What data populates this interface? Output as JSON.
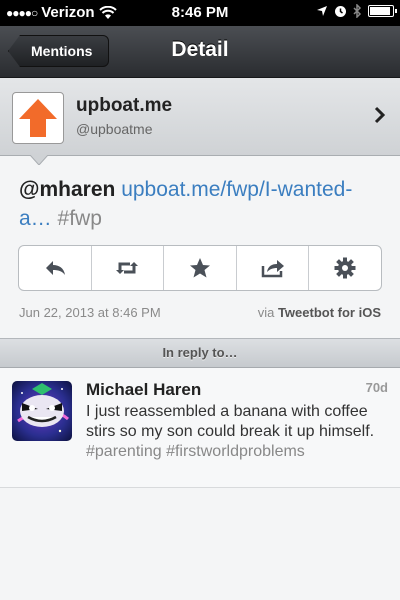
{
  "status_bar": {
    "carrier": "Verizon",
    "time": "8:46 PM"
  },
  "nav": {
    "back_label": "Mentions",
    "title": "Detail"
  },
  "user": {
    "name": "upboat.me",
    "handle": "@upboatme"
  },
  "tweet": {
    "mention": "@mharen",
    "link": "upboat.me/fwp/I-wanted-a…",
    "hashtag": "#fwp",
    "timestamp": "Jun 22, 2013 at 8:46 PM",
    "via_prefix": "via",
    "via_client": "Tweetbot for iOS"
  },
  "actions": [
    "reply-icon",
    "retweet-icon",
    "star-icon",
    "share-icon",
    "gear-icon"
  ],
  "reply_section": {
    "header": "In reply to…"
  },
  "reply": {
    "name": "Michael Haren",
    "age": "70d",
    "text": "I just reassembled a banana with coffee stirs so my son could break it up himself.",
    "hashtag1": "#parenting",
    "hashtag2": "#firstworldproblems"
  },
  "colors": {
    "link": "#3b7ec0",
    "upboat_orange": "#f26b2a"
  }
}
